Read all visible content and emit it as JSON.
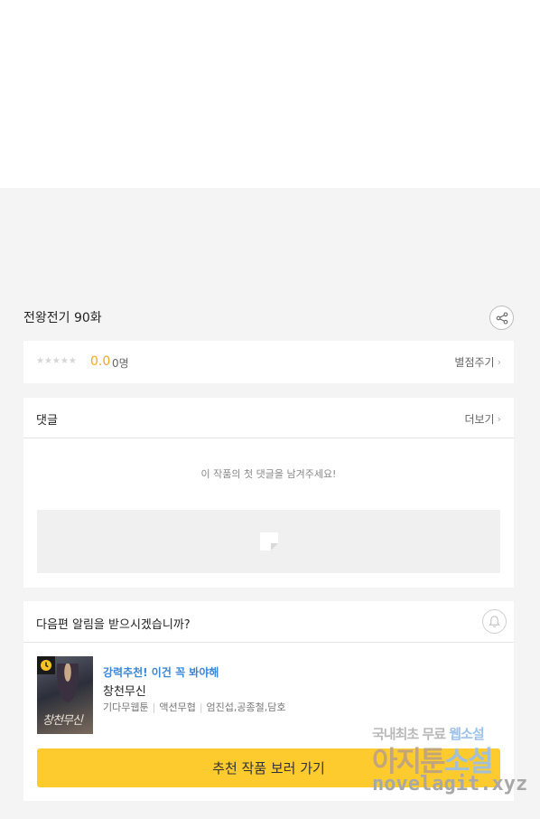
{
  "episode": {
    "title": "전왕전기 90화"
  },
  "rating": {
    "stars": "★★★★★",
    "score": "0.0",
    "count": "0명",
    "rate_link": "별점주기"
  },
  "comments": {
    "title": "댓글",
    "more_link": "더보기",
    "empty_message": "이 작품의 첫 댓글을 남겨주세요!"
  },
  "notify": {
    "question": "다음편 알림을 받으시겠습니까?"
  },
  "recommend": {
    "tag": "강력추천! 이건 꼭 봐야해",
    "name": "창천무신",
    "meta": [
      "기다무웹툰",
      "액션무협",
      "엄진섭,공종철,담호"
    ],
    "thumb_text": "창천무신",
    "cta": "추천 작품 보러 가기"
  },
  "watermark": {
    "line1_a": "국내최초 무료 ",
    "line1_b": "웹소설",
    "line2_a": "아지툰",
    "line2_b": "소설",
    "line3": "novelagit.xyz"
  },
  "colors": {
    "accent_yellow": "#fecb2e",
    "score_orange": "#f5a623",
    "tag_blue": "#3b86d6"
  }
}
